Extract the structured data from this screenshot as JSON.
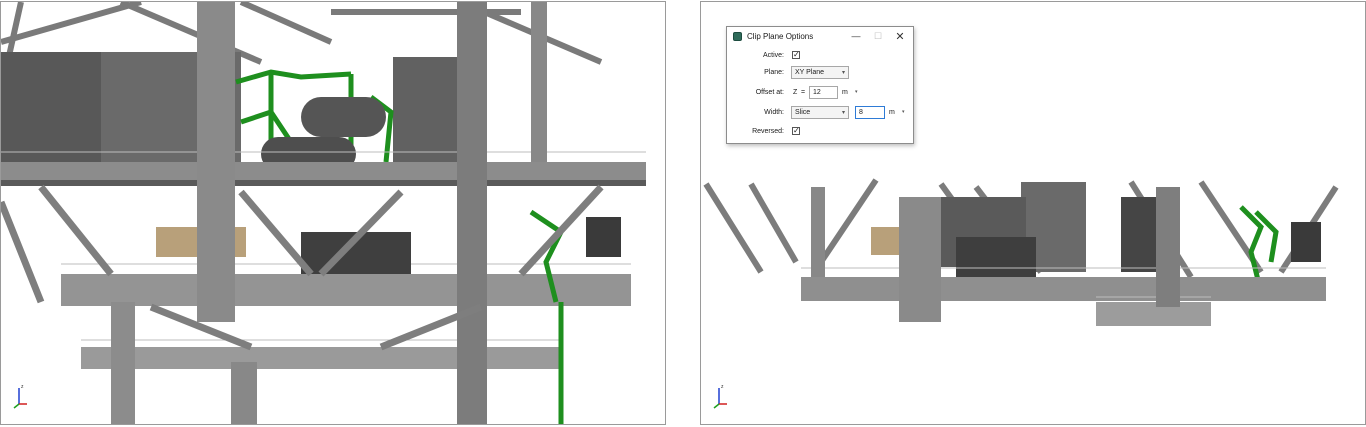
{
  "dialog": {
    "title": "Clip Plane Options",
    "buttons": {
      "minimize": "—",
      "maximize": "☐",
      "close": "✕"
    },
    "active": {
      "label": "Active:",
      "checked": "✓"
    },
    "plane": {
      "label": "Plane:",
      "value": "XY Plane"
    },
    "offset": {
      "label": "Offset at:",
      "axis": "Z",
      "equals": "=",
      "value": "12",
      "unit": "m"
    },
    "width": {
      "label": "Width:",
      "mode": "Slice",
      "value": "8",
      "unit": "m"
    },
    "reversed": {
      "label": "Reversed:",
      "checked": "✓"
    },
    "dropdown_arrow": "▾"
  },
  "triad": {
    "z": "z"
  },
  "colors": {
    "steel": "#8a8a8a",
    "steel_dark": "#4a4a4a",
    "piping_green": "#1e8f1e",
    "pipe_tan": "#b8a07a"
  }
}
